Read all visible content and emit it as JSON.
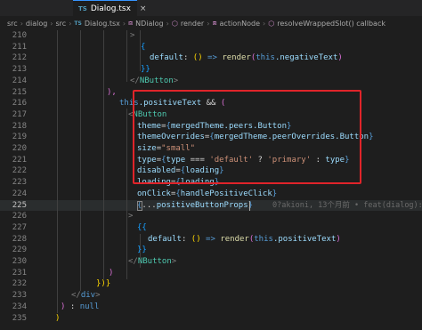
{
  "tab": {
    "lang_badge": "TS",
    "filename": "Dialog.tsx",
    "close_glyph": "×"
  },
  "breadcrumb": {
    "items": [
      "src",
      "dialog",
      "src",
      "Dialog.tsx",
      "NDialog",
      "render",
      "actionNode",
      "resolveWrappedSlot() callback"
    ],
    "separator": "›",
    "ts_badge": "TS"
  },
  "editor": {
    "line_numbers": [
      "210",
      "211",
      "212",
      "213",
      "214",
      "215",
      "216",
      "217",
      "218",
      "219",
      "220",
      "221",
      "222",
      "223",
      "224",
      "225",
      "226",
      "227",
      "228",
      "229",
      "230",
      "231",
      "232",
      "233",
      "234",
      "235"
    ],
    "active_line": "225",
    "blame": "0?akioni, 13个月前 • feat(dialog):"
  },
  "colors": {
    "background": "#1e1e1e",
    "highlight_border": "#e0242a",
    "keyword": "#569cd6",
    "component": "#4ec9b0",
    "string": "#ce9178",
    "property": "#9cdcfe"
  },
  "code": {
    "l210": [
      ">"
    ],
    "l211": [
      "{"
    ],
    "l212": [
      "default",
      ":",
      "()",
      "=>",
      "render",
      "(",
      "this",
      ".negativeText",
      ")"
    ],
    "l213": [
      "}}"
    ],
    "l214": [
      "</",
      "NButton",
      ">"
    ],
    "l215": [
      "),"
    ],
    "l216": [
      "this",
      ".positiveText",
      "&&",
      "("
    ],
    "l217": [
      "<",
      "NButton"
    ],
    "l218": [
      "theme",
      "=",
      "{",
      "mergedTheme",
      ".peers.Button",
      "}"
    ],
    "l219": [
      "themeOverrides",
      "=",
      "{",
      "mergedTheme",
      ".peerOverrides.Button",
      "}"
    ],
    "l220": [
      "size",
      "=",
      "\"small\""
    ],
    "l221": [
      "type",
      "=",
      "{",
      "type",
      "===",
      "'default'",
      "?",
      "'primary'",
      ":",
      "type",
      "}"
    ],
    "l222": [
      "disabled",
      "=",
      "{",
      "loading",
      "}"
    ],
    "l223": [
      "loading",
      "=",
      "{",
      "loading",
      "}"
    ],
    "l224": [
      "onClick",
      "=",
      "{",
      "handlePositiveClick",
      "}"
    ],
    "l225": [
      "{",
      "...",
      "positiveButtonProps",
      "}"
    ],
    "l226": [
      ">"
    ],
    "l227": [
      "{{"
    ],
    "l228": [
      "default",
      ":",
      "()",
      "=>",
      "render",
      "(",
      "this",
      ".positiveText",
      ")"
    ],
    "l229": [
      "}}"
    ],
    "l230": [
      "</",
      "NButton",
      ">"
    ],
    "l231": [
      ")"
    ],
    "l232": [
      "})}"
    ],
    "l233": [
      "</",
      "div",
      ">"
    ],
    "l234": [
      ")",
      ":",
      "null"
    ],
    "l235": [
      ")"
    ]
  }
}
